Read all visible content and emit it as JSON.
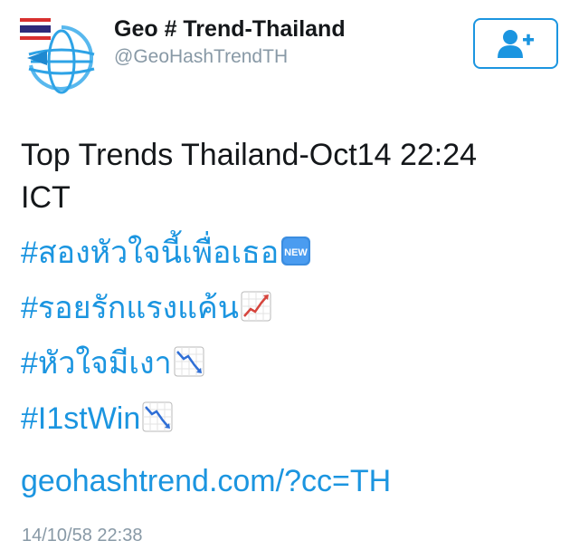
{
  "author": {
    "display_name": "Geo # Trend-Thailand",
    "handle": "@GeoHashTrendTH"
  },
  "follow_button": {
    "icon": "add-user-icon"
  },
  "tweet": {
    "text_line_1": "Top Trends Thailand-Oct14 22:24",
    "text_line_2": "ICT",
    "hashtags": [
      {
        "text": "#สองหัวใจนี้เพื่อเธอ",
        "emoji": "new-button-icon"
      },
      {
        "text": "#รอยรักแรงแค้น",
        "emoji": "chart-increasing-icon"
      },
      {
        "text": "#หัวใจมีเงา",
        "emoji": "chart-decreasing-icon"
      },
      {
        "text": "#I1stWin",
        "emoji": "chart-decreasing-icon"
      }
    ],
    "link": "geohashtrend.com/?cc=TH",
    "timestamp": "14/10/58 22:38"
  },
  "colors": {
    "link_blue": "#1b95e0",
    "text": "#14171a",
    "muted": "#8899a6",
    "emoji_new_blue": "#3b8de0",
    "trend_up_red": "#d6453d",
    "trend_down_blue": "#2f6fd6"
  }
}
